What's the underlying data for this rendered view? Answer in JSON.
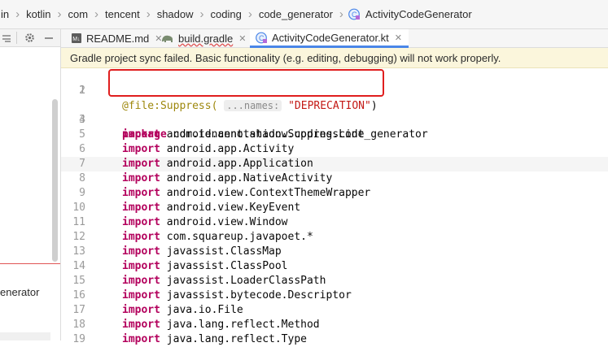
{
  "breadcrumbs": [
    "in",
    "kotlin",
    "com",
    "tencent",
    "shadow",
    "coding",
    "code_generator",
    "ActivityCodeGenerator"
  ],
  "left_panel": {
    "item_text": "enerator"
  },
  "tabs": [
    {
      "label": "README.md",
      "active": false
    },
    {
      "label": "build.gradle",
      "active": false
    },
    {
      "label": "ActivityCodeGenerator.kt",
      "active": true
    }
  ],
  "banner": {
    "text": "Gradle project sync failed. Basic functionality (e.g. editing, debugging) will not work properly."
  },
  "code": {
    "line1": {
      "prefix": "@file:Suppress(",
      "hint": "...names:",
      "string": "\"DEPRECATION\"",
      "suffix": ")"
    },
    "package_kw": "package",
    "package_name": "com.tencent.shadow.coding.code_generator",
    "import_kw": "import",
    "imports": [
      "android.annotation.SuppressLint",
      "android.app.Activity",
      "android.app.Application",
      "android.app.NativeActivity",
      "android.view.ContextThemeWrapper",
      "android.view.KeyEvent",
      "android.view.Window",
      "com.squareup.javapoet.*",
      "javassist.ClassMap",
      "javassist.ClassPool",
      "javassist.LoaderClassPath",
      "javassist.bytecode.Descriptor",
      "java.io.File",
      "java.lang.reflect.Method",
      "java.lang.reflect.Type"
    ],
    "line_numbers": [
      "1",
      "2",
      "3",
      "4",
      "5",
      "6",
      "7",
      "8",
      "9",
      "10",
      "11",
      "12",
      "13",
      "14",
      "15",
      "16",
      "17",
      "18",
      "19"
    ]
  },
  "colors": {
    "accent": "#4a86e8",
    "highlight_box": "#e01e1e",
    "banner_bg": "#fbf6dc"
  }
}
